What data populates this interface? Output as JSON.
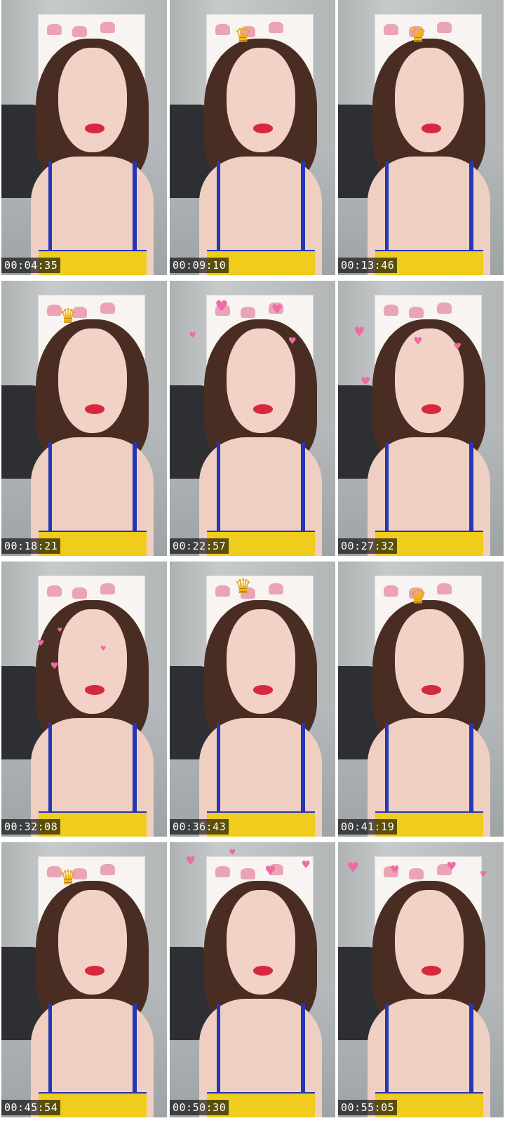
{
  "thumbnails": [
    {
      "timestamp": "00:04:35",
      "overlay": "none"
    },
    {
      "timestamp": "00:09:10",
      "overlay": "crown"
    },
    {
      "timestamp": "00:13:46",
      "overlay": "crown"
    },
    {
      "timestamp": "00:18:21",
      "overlay": "crown"
    },
    {
      "timestamp": "00:22:57",
      "overlay": "hearts"
    },
    {
      "timestamp": "00:27:32",
      "overlay": "hearts"
    },
    {
      "timestamp": "00:32:08",
      "overlay": "hearts"
    },
    {
      "timestamp": "00:36:43",
      "overlay": "crown"
    },
    {
      "timestamp": "00:41:19",
      "overlay": "crown"
    },
    {
      "timestamp": "00:45:54",
      "overlay": "crown"
    },
    {
      "timestamp": "00:50:30",
      "overlay": "hearts"
    },
    {
      "timestamp": "00:55:05",
      "overlay": "hearts"
    }
  ],
  "colors": {
    "stamp_bg": "#000000",
    "stamp_text": "#ffffff",
    "top_yellow": "#f0cc1c",
    "strap_blue": "#2536b8",
    "heart_pink": "#f06aa8",
    "crown_gold": "#f2b31a"
  },
  "icons": {
    "crown": "crown-icon",
    "heart": "heart-icon"
  }
}
